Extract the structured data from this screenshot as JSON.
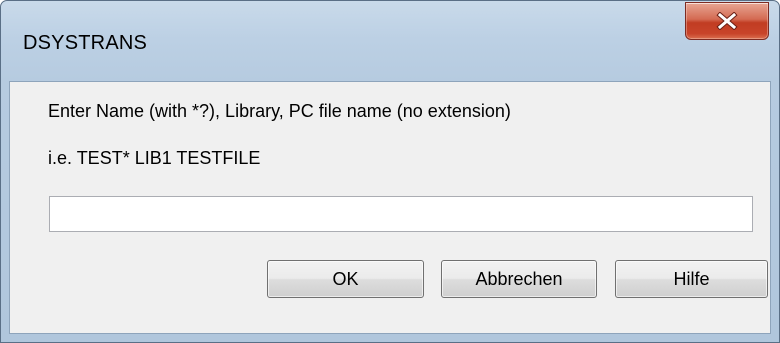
{
  "window": {
    "title": "DSYSTRANS"
  },
  "titlebar": {
    "close_icon": "close-x-icon",
    "close_color": "#c8442a"
  },
  "dialog": {
    "prompt": "Enter Name (with *?), Library, PC file name (no extension)",
    "example": "i.e. TEST* LIB1 TESTFILE",
    "input_value": "",
    "input_placeholder": ""
  },
  "buttons": {
    "ok_label": "OK",
    "cancel_label": "Abbrechen",
    "help_label": "Hilfe"
  }
}
